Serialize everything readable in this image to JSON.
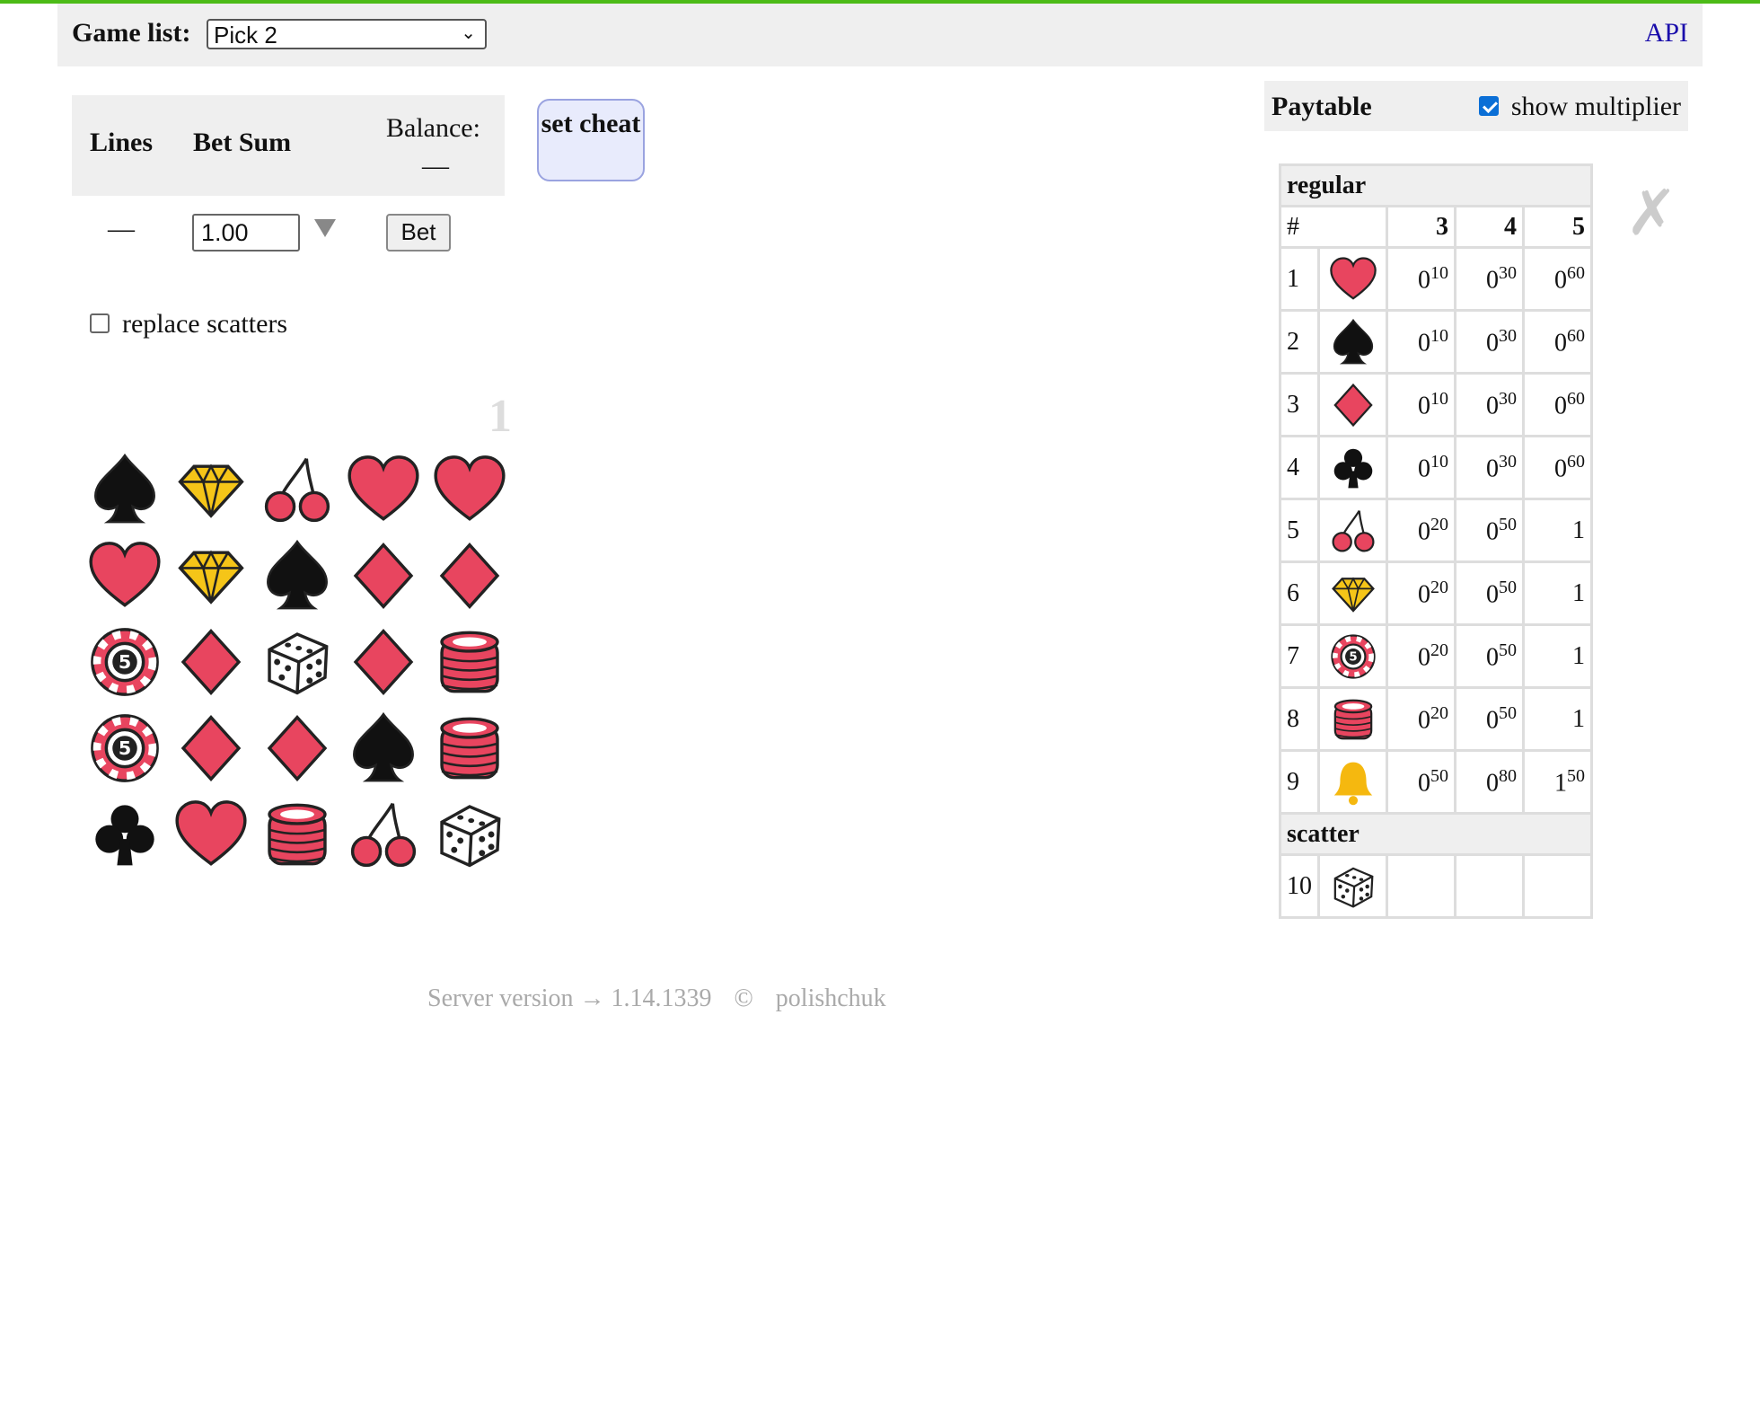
{
  "header": {
    "game_list_label": "Game list:",
    "selected_game": "Pick 2",
    "api_link": "API"
  },
  "bet": {
    "lines_label": "Lines",
    "bet_sum_label": "Bet Sum",
    "balance_label": "Balance:",
    "balance_value": "—",
    "lines_value": "—",
    "bet_value": "1.00",
    "bet_button": "Bet"
  },
  "cheat_button": "set cheat",
  "replace_scatters": {
    "label": "replace scatters",
    "checked": false
  },
  "reel_number": "1",
  "reels": [
    [
      "spade",
      "diamond-gem",
      "cherry",
      "heart",
      "heart"
    ],
    [
      "heart",
      "diamond-gem",
      "spade",
      "diamond",
      "diamond"
    ],
    [
      "chip",
      "diamond",
      "dice",
      "diamond",
      "chip-stack"
    ],
    [
      "chip",
      "diamond",
      "diamond",
      "spade",
      "chip-stack"
    ],
    [
      "club",
      "heart",
      "chip-stack",
      "cherry",
      "dice"
    ]
  ],
  "footer": {
    "server_version": "Server version → 1.14.1339",
    "copyright": "©",
    "author": "polishchuk"
  },
  "paytable": {
    "title": "Paytable",
    "show_multiplier": {
      "label": "show multiplier",
      "checked": true
    },
    "close": "✗",
    "regular_label": "regular",
    "scatter_label": "scatter",
    "columns": [
      "#",
      "3",
      "4",
      "5"
    ],
    "rows": [
      {
        "n": "1",
        "icon": "heart",
        "v": [
          [
            "0",
            "10"
          ],
          [
            "0",
            "30"
          ],
          [
            "0",
            "60"
          ]
        ]
      },
      {
        "n": "2",
        "icon": "spade",
        "v": [
          [
            "0",
            "10"
          ],
          [
            "0",
            "30"
          ],
          [
            "0",
            "60"
          ]
        ]
      },
      {
        "n": "3",
        "icon": "diamond",
        "v": [
          [
            "0",
            "10"
          ],
          [
            "0",
            "30"
          ],
          [
            "0",
            "60"
          ]
        ]
      },
      {
        "n": "4",
        "icon": "club",
        "v": [
          [
            "0",
            "10"
          ],
          [
            "0",
            "30"
          ],
          [
            "0",
            "60"
          ]
        ]
      },
      {
        "n": "5",
        "icon": "cherry",
        "v": [
          [
            "0",
            "20"
          ],
          [
            "0",
            "50"
          ],
          [
            "1",
            ""
          ]
        ]
      },
      {
        "n": "6",
        "icon": "diamond-gem",
        "v": [
          [
            "0",
            "20"
          ],
          [
            "0",
            "50"
          ],
          [
            "1",
            ""
          ]
        ]
      },
      {
        "n": "7",
        "icon": "chip",
        "v": [
          [
            "0",
            "20"
          ],
          [
            "0",
            "50"
          ],
          [
            "1",
            ""
          ]
        ]
      },
      {
        "n": "8",
        "icon": "chip-stack",
        "v": [
          [
            "0",
            "20"
          ],
          [
            "0",
            "50"
          ],
          [
            "1",
            ""
          ]
        ]
      },
      {
        "n": "9",
        "icon": "bell",
        "v": [
          [
            "0",
            "50"
          ],
          [
            "0",
            "80"
          ],
          [
            "1",
            "50"
          ]
        ]
      }
    ],
    "scatter_rows": [
      {
        "n": "10",
        "icon": "dice",
        "v": [
          [
            "",
            ""
          ],
          [
            "",
            ""
          ],
          [
            "",
            ""
          ]
        ]
      }
    ]
  },
  "colors": {
    "accent_green": "#4cbb17",
    "red": "#e8455f",
    "gold": "#f5c518",
    "link": "#1a0dab"
  }
}
